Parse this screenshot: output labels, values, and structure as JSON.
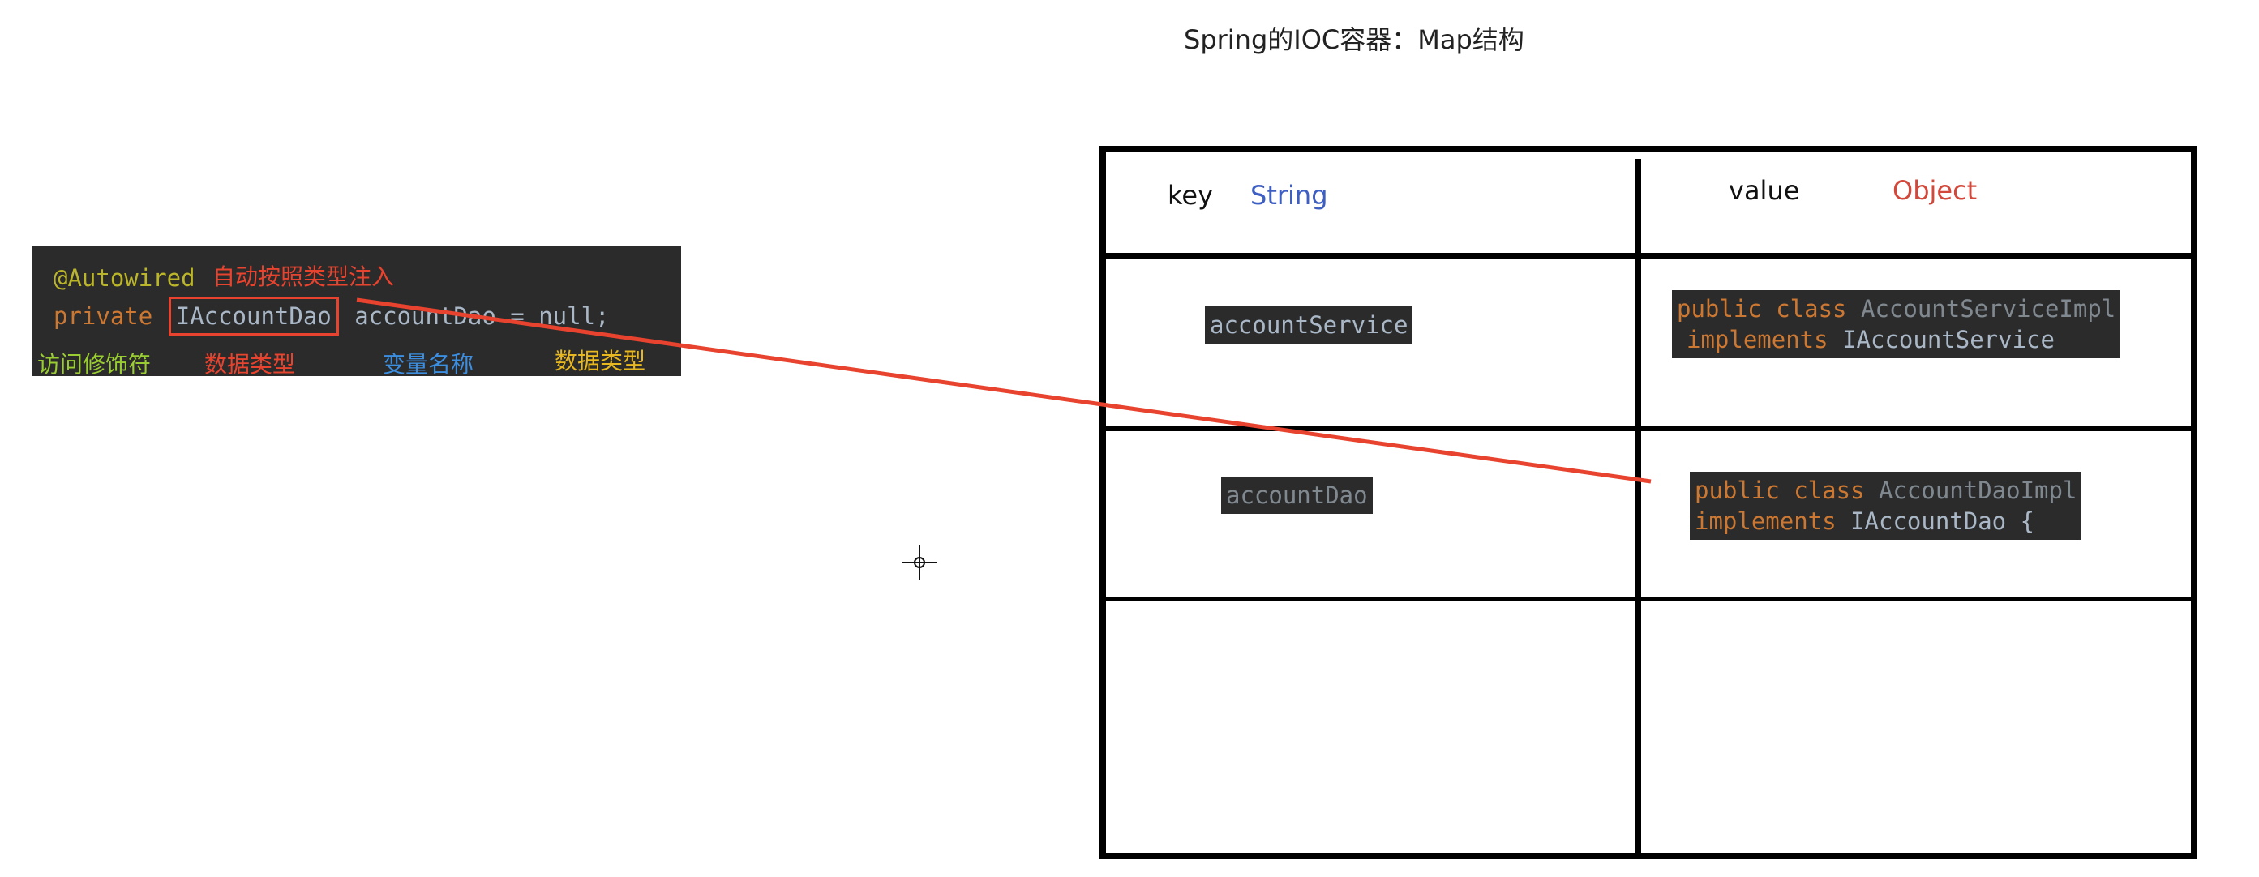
{
  "title": "Spring的IOC容器：Map结构",
  "code_snippet": {
    "line1_annotation": "@Autowired",
    "line1_note": "自动按照类型注入",
    "line2_modifier": "private",
    "line2_type": "IAccountDao",
    "line2_rest": "accountDao = null;",
    "labels": {
      "access_modifier": "访问修饰符",
      "data_type": "数据类型",
      "variable_name": "变量名称",
      "data_type_2": "数据类型"
    }
  },
  "map_table": {
    "header": {
      "key_label": "key",
      "key_type": "String",
      "value_label": "value",
      "value_type": "Object"
    },
    "rows": [
      {
        "key": "accountService",
        "value_line1_kw": "public class",
        "value_line1_name": "AccountServiceImpl",
        "value_line2_kw": "implements",
        "value_line2_name": "IAccountService"
      },
      {
        "key": "accountDao",
        "value_line1_kw": "public class",
        "value_line1_name": "AccountDaoImpl",
        "value_line2_kw": "implements",
        "value_line2_name": "IAccountDao {"
      }
    ]
  },
  "colors": {
    "connector": "#e8432e",
    "key_type": "#3e5fc2",
    "value_type": "#d2483a",
    "code_bg": "#2b2b2b"
  }
}
